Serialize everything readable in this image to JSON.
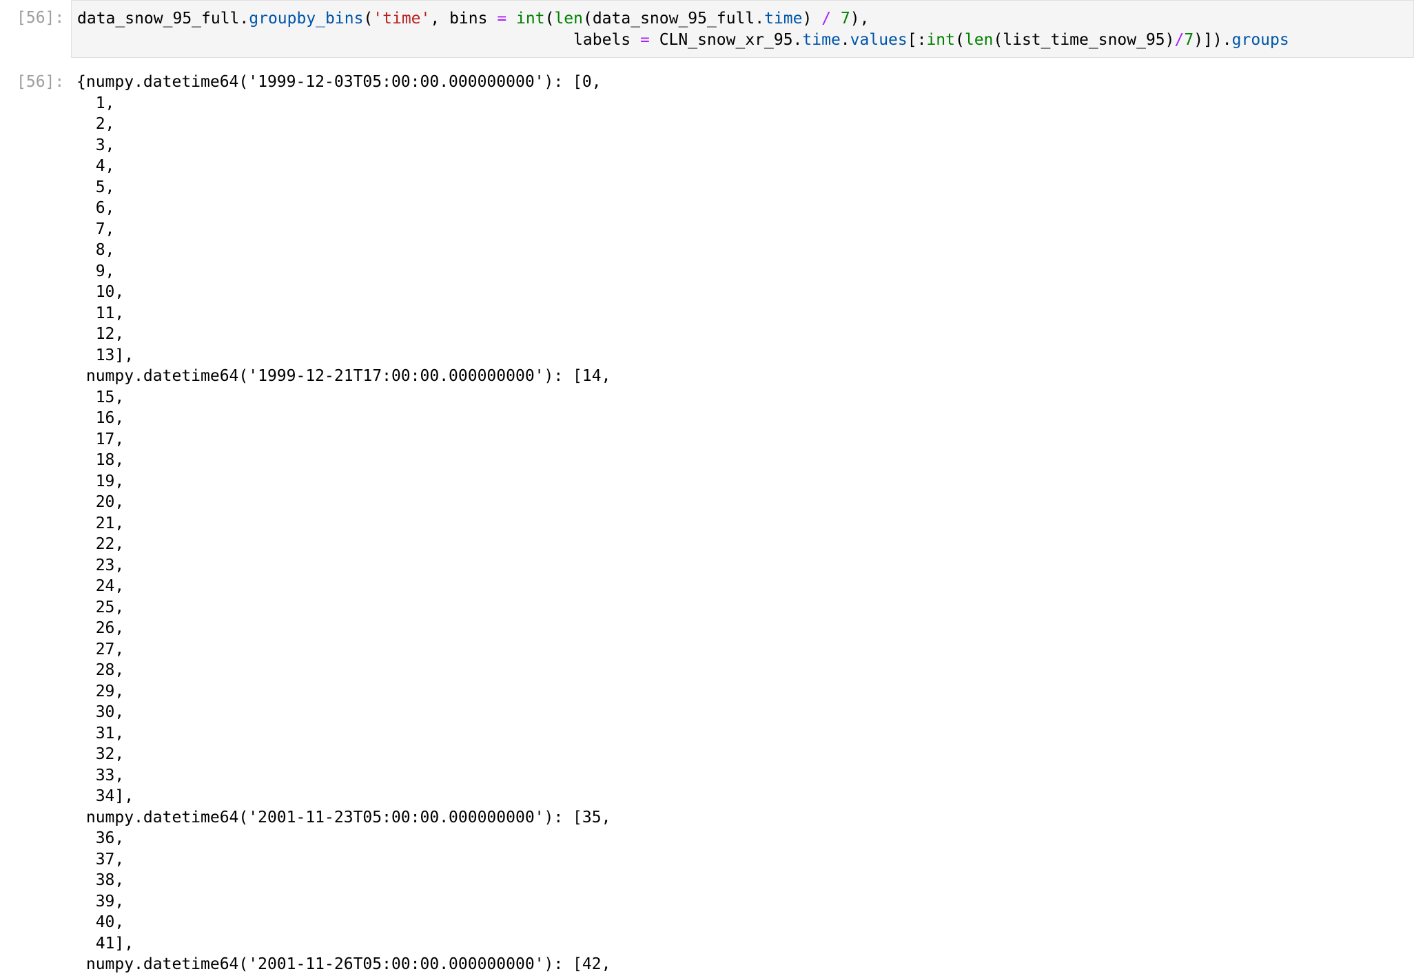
{
  "input_cell": {
    "prompt": "[56]:",
    "code_lines": [
      [
        {
          "t": "data_snow_95_full.",
          "c": "plain"
        },
        {
          "t": "groupby_bins",
          "c": "fn"
        },
        {
          "t": "(",
          "c": "plain"
        },
        {
          "t": "'time'",
          "c": "str"
        },
        {
          "t": ", bins ",
          "c": "plain"
        },
        {
          "t": "=",
          "c": "op"
        },
        {
          "t": " ",
          "c": "plain"
        },
        {
          "t": "int",
          "c": "builtin"
        },
        {
          "t": "(",
          "c": "plain"
        },
        {
          "t": "len",
          "c": "builtin"
        },
        {
          "t": "(data_snow_95_full.",
          "c": "plain"
        },
        {
          "t": "time",
          "c": "attr"
        },
        {
          "t": ") ",
          "c": "plain"
        },
        {
          "t": "/",
          "c": "op"
        },
        {
          "t": " ",
          "c": "plain"
        },
        {
          "t": "7",
          "c": "num"
        },
        {
          "t": "),",
          "c": "plain"
        }
      ],
      [
        {
          "t": "                                                    labels ",
          "c": "plain"
        },
        {
          "t": "=",
          "c": "op"
        },
        {
          "t": " CLN_snow_xr_95.",
          "c": "plain"
        },
        {
          "t": "time",
          "c": "attr"
        },
        {
          "t": ".",
          "c": "plain"
        },
        {
          "t": "values",
          "c": "attr"
        },
        {
          "t": "[:",
          "c": "plain"
        },
        {
          "t": "int",
          "c": "builtin"
        },
        {
          "t": "(",
          "c": "plain"
        },
        {
          "t": "len",
          "c": "builtin"
        },
        {
          "t": "(list_time_snow_95)",
          "c": "plain"
        },
        {
          "t": "/",
          "c": "op"
        },
        {
          "t": "7",
          "c": "num"
        },
        {
          "t": ")]).",
          "c": "plain"
        },
        {
          "t": "groups",
          "c": "attr"
        }
      ]
    ]
  },
  "output_cell": {
    "prompt": "[56]:",
    "lines": [
      "{numpy.datetime64('1999-12-03T05:00:00.000000000'): [0,",
      "  1,",
      "  2,",
      "  3,",
      "  4,",
      "  5,",
      "  6,",
      "  7,",
      "  8,",
      "  9,",
      "  10,",
      "  11,",
      "  12,",
      "  13],",
      " numpy.datetime64('1999-12-21T17:00:00.000000000'): [14,",
      "  15,",
      "  16,",
      "  17,",
      "  18,",
      "  19,",
      "  20,",
      "  21,",
      "  22,",
      "  23,",
      "  24,",
      "  25,",
      "  26,",
      "  27,",
      "  28,",
      "  29,",
      "  30,",
      "  31,",
      "  32,",
      "  33,",
      "  34],",
      " numpy.datetime64('2001-11-23T05:00:00.000000000'): [35,",
      "  36,",
      "  37,",
      "  38,",
      "  39,",
      "  40,",
      "  41],",
      " numpy.datetime64('2001-11-26T05:00:00.000000000'): [42,"
    ]
  }
}
